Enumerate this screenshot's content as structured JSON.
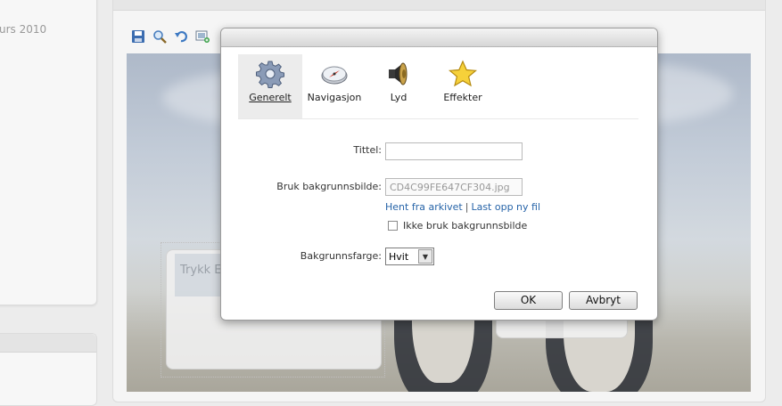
{
  "sidebar": {
    "date_fragment": "urs 2010"
  },
  "stage": {
    "textbox_label": "Trykk El"
  },
  "dialog": {
    "tabs": [
      {
        "label": "Generelt",
        "icon": "gear-icon",
        "active": true
      },
      {
        "label": "Navigasjon",
        "icon": "compass-icon",
        "active": false
      },
      {
        "label": "Lyd",
        "icon": "speaker-icon",
        "active": false
      },
      {
        "label": "Effekter",
        "icon": "star-icon",
        "active": false
      }
    ],
    "form": {
      "title_label": "Tittel:",
      "title_value": "",
      "bg_image_label": "Bruk bakgrunnsbilde:",
      "bg_image_value": "CD4C99FE647CF304.jpg",
      "link_archive": "Hent fra arkivet",
      "link_separator": "|",
      "link_upload": "Last opp ny fil",
      "no_bg_label": "Ikke bruk bakgrunnsbilde",
      "no_bg_checked": false,
      "bg_color_label": "Bakgrunnsfarge:",
      "bg_color_value": "Hvit"
    },
    "buttons": {
      "ok": "OK",
      "cancel": "Avbryt"
    }
  },
  "colors": {
    "link": "#2764a8",
    "active_tab": "#ececec"
  }
}
